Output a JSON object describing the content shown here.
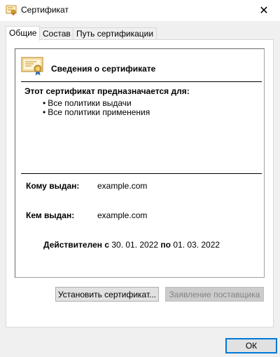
{
  "window": {
    "title": "Сертификат",
    "close_glyph": "✕"
  },
  "tabs": [
    {
      "label": "Общие",
      "active": true
    },
    {
      "label": "Состав",
      "active": false
    },
    {
      "label": "Путь сертификации",
      "active": false
    }
  ],
  "header": {
    "title": "Сведения о сертификате",
    "icon": "certificate-icon"
  },
  "purpose": {
    "heading": "Этот сертификат предназначается для:",
    "items": [
      "Все политики выдачи",
      "Все политики применения"
    ]
  },
  "issued_to": {
    "label": "Кому выдан:",
    "value": "example.com"
  },
  "issued_by": {
    "label": "Кем выдан:",
    "value": "example.com"
  },
  "validity": {
    "from_label": "Действителен с",
    "from": "30. 01. 2022",
    "to_label": "по",
    "to": "01. 03. 2022"
  },
  "buttons": {
    "install": "Установить сертификат...",
    "issuer_statement": "Заявление поставщика",
    "ok": "ОК"
  },
  "colors": {
    "accent": "#0078d7",
    "window_bg": "#f0f0f0",
    "panel_bg": "#ffffff"
  }
}
